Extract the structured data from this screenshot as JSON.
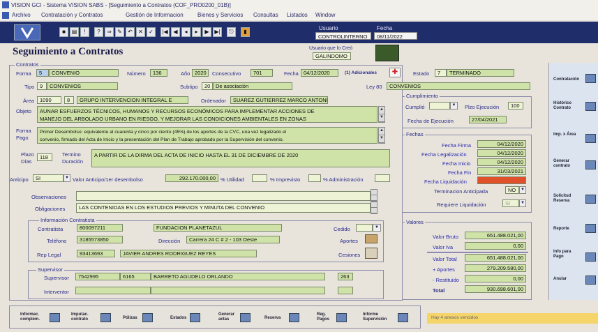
{
  "window": {
    "title": "VISION GCI - Sistema VISION SABS - [Seguimiento a Contratos (COF_PRO0200_01B)]"
  },
  "menu": [
    "Archivo",
    "Contratación y Contratos",
    "Gestión de Informacion",
    "Bienes y Servicios",
    "Consultas",
    "Listados",
    "Window"
  ],
  "header": {
    "usuario_label": "Usuario",
    "usuario": "CONTROLINTERNO",
    "fecha_label": "Fecha",
    "fecha": "08/11/2022",
    "creo_label": "Usuario que lo Creó",
    "creo": "GALINDOMO"
  },
  "page": {
    "title": "Seguimiento a Contratos"
  },
  "contrato": {
    "group_title": "Contratos",
    "forma_label": "Forma",
    "forma_code": "5",
    "forma": "CONVENIO",
    "numero_label": "Número",
    "numero": "136",
    "anio_label": "Año",
    "anio": "2020",
    "consecutivo_label": "Consecutivo",
    "consecutivo": "701",
    "fecha_label": "Fecha",
    "fecha": "04/12/2020",
    "adicionales": "(1) Adicionales",
    "estado_label": "Estado",
    "estado_code": "7",
    "estado": "TERMINADO",
    "tipo_label": "Tipo",
    "tipo_code": "9",
    "tipo": "CONVENIOS",
    "subtipo_label": "Subtipo",
    "subtipo_code": "20",
    "subtipo": "De asociación",
    "ley_label": "Ley 80",
    "ley": "CONVENIOS",
    "area_label": "Área",
    "area_code": "1090",
    "area_sub": "8",
    "area": "GRUPO INTERVENCION INTEGRAL E",
    "ordenador_label": "Ordenador",
    "ordenador": "SUAREZ GUTIERREZ MARCO ANTONIO",
    "objeto_label": "Objeto",
    "objeto_1": "AUNAR ESFUERZOS TÉCNICOS, HUMANOS Y RECURSOS ECONÓMICOS PARA IMPLEMENTAR ACCIONES DE",
    "objeto_2": "MANEJO DEL ARBOLADO URBANO EN RIESGO, Y MEJORAR LAS CONDICIONES AMBIENTALES EN ZONAS",
    "forma_pago_label_1": "Forma",
    "forma_pago_label_2": "Pago",
    "forma_pago_1": "Primer Desembolso: equivalente al cuarenta y cinco por ciento (45%) de los aportes de la CVC, una vez legalizado el",
    "forma_pago_2": "convenio, firmado del Acta de Inicio y la presentación del Plan de Trabajo aprobado por la Supervisión del convenio.",
    "plazo_label_1": "Plazo",
    "plazo_label_2": "Días",
    "plazo": "118",
    "termino_label_1": "Termino",
    "termino_label_2": "Duración",
    "termino": "A PARTIR DE LA DIRMA DEL ACTA DE INICIO HASTA EL 31 DE DICIEMBRE DE 2020",
    "anticipo_label": "Anticipo",
    "anticipo": "SI",
    "valor_anticipo_label": "Valor Anticipo/1er desembolso",
    "valor_anticipo": "292.170.000,00",
    "utilidad_label": "% Utilidad",
    "imprevisto_label": "% Imprevisto",
    "administracion_label": "% Administración",
    "observaciones_label": "Observaciones",
    "observaciones": "",
    "obligaciones_label": "Obligaciones",
    "obligaciones": "LAS CONTENIDAS EN LOS ESTUDIOS PREVIOS Y MINUTA DEL CONVENIO"
  },
  "contratista": {
    "group_title": "Información Contratista",
    "contratista_label": "Contratista",
    "nit": "800097211",
    "nombre": "FUNDACION PLANETAZUL",
    "cedido_label": "Cedido",
    "telefono_label": "Teléfono",
    "telefono": "3185573850",
    "direccion_label": "Dirección",
    "direccion": "Carrera 24 C # 2 - 103 Oeste",
    "aportes_label": "Aportes",
    "rep_label": "Rep Legal",
    "rep_id": "93413693",
    "rep_nombre": "JAVIER ANDRES RODRIGUEZ REYES",
    "cesiones_label": "Cesiones"
  },
  "supervisor": {
    "group_title": "Supervisor",
    "supervisor_label": "Supervisor",
    "supervisor_id": "7542995",
    "supervisor_code": "6165",
    "supervisor_nombre": "BARRETO AGUDELO ORLANDO",
    "supervisor_extra": "263",
    "interventor_label": "Interventor"
  },
  "cumplimiento": {
    "group_title": "Cumplimiento",
    "cumplio_label": "Cumplió",
    "plazo_ejec_label": "Plzo Ejecución",
    "plazo_ejec": "100",
    "fecha_ejec_label": "Fecha de Ejecución",
    "fecha_ejec": "27/04/2021"
  },
  "fechas": {
    "group_title": "Fechas",
    "firma_label": "Fecha Firma",
    "firma": "04/12/2020",
    "legal_label": "Fecha Legalización",
    "legal": "04/12/2020",
    "inicio_label": "Fecha Inicio",
    "inicio": "04/12/2020",
    "fin_label": "Fecha Fin",
    "fin": "31/03/2021",
    "liquidacion_label": "Fecha Liquidación",
    "liquidacion": "",
    "terminacion_label": "Terminacion Anticipada",
    "terminacion": "NO",
    "requiere_label": "Requiere Liquidación",
    "requiere": "SI"
  },
  "valores": {
    "group_title": "Valores",
    "bruto_label": "Valor Bruto",
    "bruto": "651.488.021,00",
    "iva_label": "Valor Iva",
    "iva": "0,00",
    "total_label": "Valor Total",
    "total": "651.488.021,00",
    "aportes_label": "+ Aportes",
    "aportes": "279.209.580,00",
    "restituido_label": "- Restituido",
    "restituido": "0,00",
    "gran_total_label": "Total",
    "gran_total": "930.698.601,00"
  },
  "right_panel": [
    {
      "label": "Contratación"
    },
    {
      "label": "Histórico Contrato"
    },
    {
      "label": "Imp. x Área"
    },
    {
      "label": "Generar contrato"
    },
    {
      "label": "Solicitud Reserva"
    },
    {
      "label": "Reporte"
    },
    {
      "label": "Info para Pago"
    },
    {
      "label": "Anular"
    }
  ],
  "bottom": [
    {
      "label": "Informac. complem."
    },
    {
      "label": "Imputac. contrato"
    },
    {
      "label": "Pólizas"
    },
    {
      "label": "Estados"
    },
    {
      "label": "Generar actas"
    },
    {
      "label": "Reserva"
    },
    {
      "label": "Reg. Pagos"
    },
    {
      "label": "Informe Supervisión"
    }
  ],
  "status": {
    "text": "Hay 4 anexos vencidos"
  },
  "colors": {
    "toolbar": "#1f2d6a",
    "field": "#cfe2a8",
    "status": "#f5d46a"
  }
}
